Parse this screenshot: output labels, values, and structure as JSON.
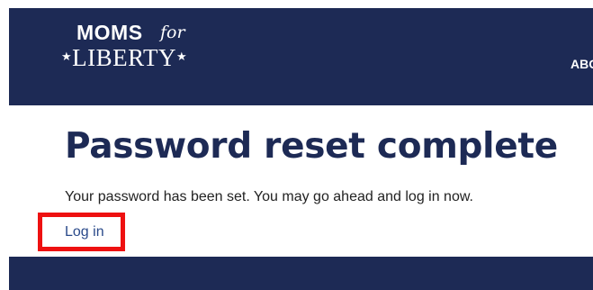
{
  "header": {
    "logo": {
      "line1": "MOMS",
      "line1_suffix": "for",
      "line2": "LIBERTY",
      "star": "★"
    },
    "nav_visible_label": "ABO"
  },
  "main": {
    "title": "Password reset complete",
    "message": "Your password has been set. You may go ahead and log in now.",
    "login_link": "Log in"
  },
  "colors": {
    "brand_navy": "#1d2a55",
    "highlight_red": "#ee1111",
    "link": "#2a4a8a"
  }
}
